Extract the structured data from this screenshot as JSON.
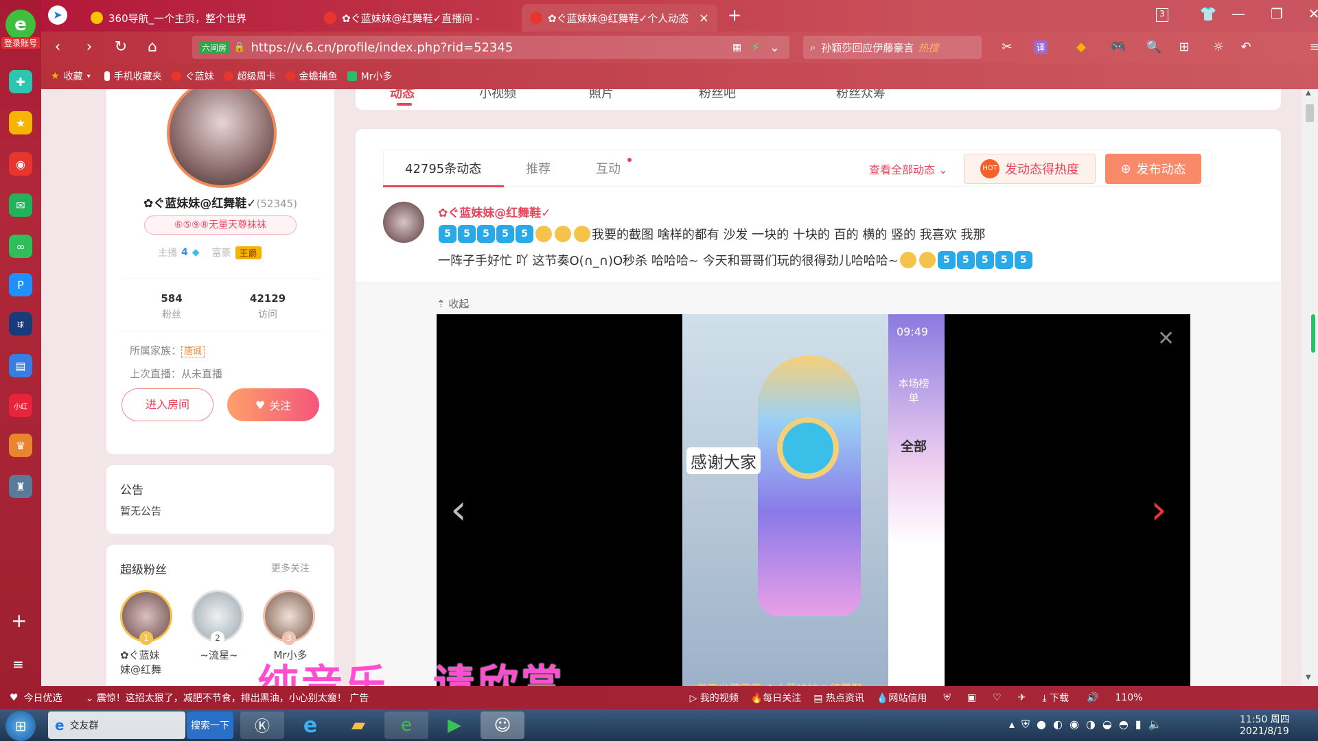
{
  "browser": {
    "logo_label": "登录账号",
    "tabs": [
      {
        "label": "360导航_一个主页，整个世界",
        "color": "#f7c400"
      },
      {
        "label": "✿ぐ蓝妹妹@红舞鞋✓直播间 - ",
        "color": "#e8352e"
      },
      {
        "label": "✿ぐ蓝妹妹@红舞鞋✓个人动态",
        "color": "#e8352e"
      }
    ],
    "tab_count": "3",
    "url": "https://v.6.cn/profile/index.php?rid=52345",
    "url_badge": "六间房",
    "search_text": "孙颖莎回应伊藤豪言",
    "search_badge": "热搜",
    "bookmarks": [
      {
        "label": "收藏",
        "color": "#f5b400"
      },
      {
        "label": "手机收藏夹",
        "color": "#ffffff"
      },
      {
        "label": "ぐ蓝妹",
        "color": "#e8352e"
      },
      {
        "label": "超级周卡",
        "color": "#e8352e"
      },
      {
        "label": "金蟾捕鱼",
        "color": "#e8352e"
      },
      {
        "label": "Mr小多",
        "color": "#2ac06a"
      }
    ]
  },
  "profile": {
    "name": "✿ぐ蓝妹妹@红舞鞋✓",
    "rid": "(52345)",
    "badge": "⑥⑤⑨⑧无量天尊袜袜",
    "anchor_label": "主播",
    "anchor_level": "4",
    "rich_label": "富豪",
    "rich_level": "王爵",
    "fans_count": "584",
    "fans_label": "粉丝",
    "visit_count": "42129",
    "visit_label": "访问",
    "family_label": "所属家族：",
    "family_value": "唐诚",
    "last_live": "上次直播：从未直播",
    "enter_room": "进入房间",
    "follow": "关注"
  },
  "notice": {
    "title": "公告",
    "content": "暂无公告"
  },
  "super_fans": {
    "title": "超级粉丝",
    "more": "更多关注",
    "fans": [
      {
        "rank": "1",
        "name": "✿ぐ蓝妹\n妹@红舞"
      },
      {
        "rank": "2",
        "name": "~流星~"
      },
      {
        "rank": "3",
        "name": "Mr小多"
      }
    ]
  },
  "top_nav": [
    "动态",
    "小视频",
    "照片",
    "粉丝吧",
    "粉丝众筹"
  ],
  "feed": {
    "tabs": [
      "42795条动态",
      "推荐",
      "互动"
    ],
    "view_all": "查看全部动态",
    "hot_button": "发动态得热度",
    "post_button": "发布动态",
    "post_author": "✿ぐ蓝妹妹@红舞鞋✓",
    "post_line1": "我要的截图 啥样的都有  沙发  一块的 十块的  百的  横的  竖的  我喜欢 我那",
    "post_line2": "一阵子手好忙 吖 这节奏O(∩_∩)O秒杀 哈哈哈~  今天和哥哥们玩的很得劲儿哈哈哈~",
    "collapse": "收起",
    "video_time": "09:49",
    "video_text1": "感谢大家",
    "video_side1": "本场榜单",
    "video_side2": "全部",
    "video_bottom": "老三义薄云天  ✿ぐ蓝妹妹@红舞鞋"
  },
  "subtitle": "纯音乐，请欣赏",
  "statusbar": {
    "today": "今日优选",
    "news": "震惊！这招太狠了，减肥不节食，排出黑油，小心别太瘦！ 广告",
    "items": [
      "我的视频",
      "每日关注",
      "热点资讯",
      "网站信用"
    ],
    "download": "下载",
    "zoom": "110%"
  },
  "taskbar": {
    "app1": "交友群",
    "search": "搜索一下",
    "time": "11:50 周四",
    "date": "2021/8/19"
  }
}
